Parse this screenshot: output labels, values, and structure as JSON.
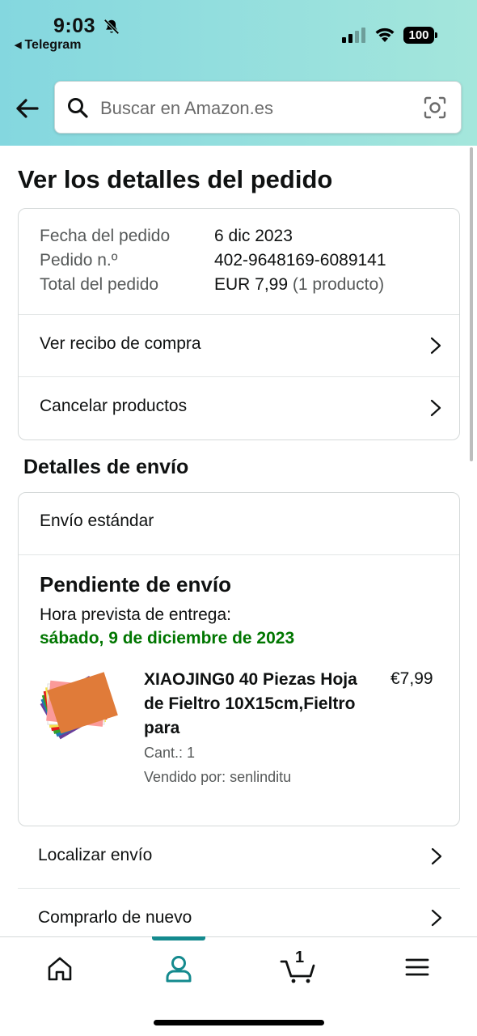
{
  "status_bar": {
    "time": "9:03",
    "back_app": "Telegram",
    "battery": "100"
  },
  "search": {
    "placeholder": "Buscar en Amazon.es"
  },
  "page": {
    "title": "Ver los detalles del pedido"
  },
  "order": {
    "date_label": "Fecha del pedido",
    "date_value": "6 dic 2023",
    "number_label": "Pedido n.º",
    "number_value": "402-9648169-6089141",
    "total_label": "Total del pedido",
    "total_value": "EUR 7,99",
    "total_count": "(1 producto)",
    "receipt_link": "Ver recibo de compra",
    "cancel_link": "Cancelar productos"
  },
  "shipping": {
    "section_title": "Detalles de envío",
    "method": "Envío estándar",
    "status": "Pendiente de envío",
    "eta_label": "Hora prevista de entrega:",
    "eta_date": "sábado, 9 de diciembre de 2023",
    "product": {
      "title": "XIAOJING0 40 Piezas Hoja de Fieltro 10X15cm,Fieltro para",
      "price": "€7,99",
      "quantity": "Cant.: 1",
      "seller": "Vendido por: senlinditu"
    },
    "track_link": "Localizar envío",
    "buy_again_link": "Comprarlo de nuevo"
  },
  "nav": {
    "cart_count": "1",
    "active": "account"
  },
  "colors": {
    "header_gradient_start": "#84d7df",
    "header_gradient_end": "#a4e6dc",
    "delivery_green": "#007600",
    "nav_accent": "#148a8e"
  }
}
